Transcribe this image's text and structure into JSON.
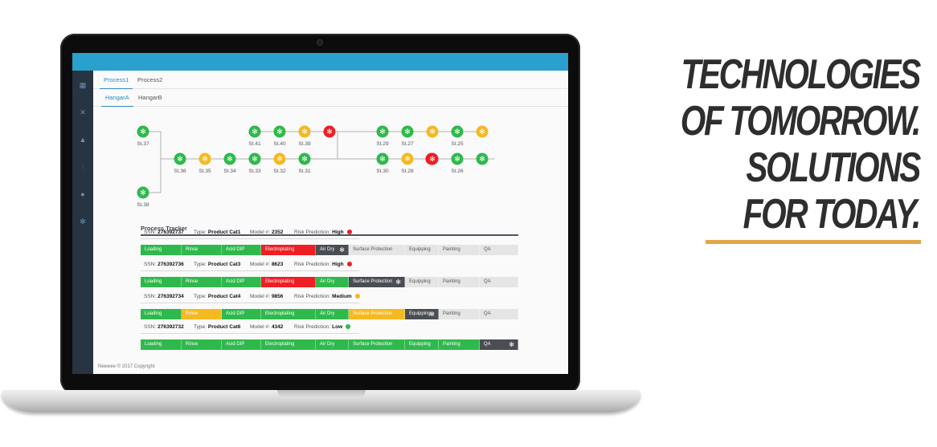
{
  "colors": {
    "green": "#2fb94c",
    "yellow": "#f5b921",
    "red": "#ee1e24",
    "dark": "#4a4d52",
    "pending": "#e5e5e5",
    "accent_line": "#e2a54a",
    "topbar": "#2aa0cc",
    "sidebar": "#273442"
  },
  "sidebar_icons": [
    "dashboard-icon",
    "tools-icon",
    "alert-icon",
    "sliders-icon",
    "users-icon",
    "settings-icon"
  ],
  "process_tabs": [
    {
      "label": "Process1",
      "active": true
    },
    {
      "label": "Process2",
      "active": false
    }
  ],
  "hangar_tabs": [
    {
      "label": "HangarA",
      "active": true
    },
    {
      "label": "HangarB",
      "active": false
    }
  ],
  "stations": [
    {
      "label": "St.37",
      "status": "green"
    },
    {
      "label": "St.38",
      "status": "green"
    },
    {
      "label": "St.36",
      "status": "green"
    },
    {
      "label": "St.35",
      "status": "yellow"
    },
    {
      "label": "St.34",
      "status": "green"
    },
    {
      "label": "St.33",
      "status": "green"
    },
    {
      "label": "St.32",
      "status": "yellow"
    },
    {
      "label": "St.31",
      "status": "green"
    },
    {
      "label": "St.41",
      "status": "green"
    },
    {
      "label": "St.40",
      "status": "green"
    },
    {
      "label": "St.39",
      "status": "yellow"
    },
    {
      "label": "",
      "status": "red"
    },
    {
      "label": "",
      "status": "red"
    },
    {
      "label": "St.29",
      "status": "green"
    },
    {
      "label": "St.27",
      "status": "green"
    },
    {
      "label": "",
      "status": "yellow"
    },
    {
      "label": "St.25",
      "status": "green"
    },
    {
      "label": "",
      "status": "yellow"
    },
    {
      "label": "St.30",
      "status": "green"
    },
    {
      "label": "St.28",
      "status": "yellow"
    },
    {
      "label": "",
      "status": "red"
    },
    {
      "label": "St.26",
      "status": "green"
    },
    {
      "label": "",
      "status": "green"
    }
  ],
  "tracker": {
    "title": "Process Tracker",
    "labels": {
      "ssn": "SSN:",
      "type": "Type:",
      "model": "Model #:",
      "risk": "Risk Prediction:"
    },
    "stage_names": [
      "Loading",
      "Rinse",
      "Acid DIP",
      "Electroplating",
      "Air Dry",
      "Surface Protection",
      "Equipping",
      "Painting",
      "QA"
    ],
    "items": [
      {
        "ssn": "276392737",
        "type": "Product Cat1",
        "model": "2352",
        "risk": "High",
        "risk_color": "red",
        "stages": [
          "green",
          "green",
          "green",
          "red",
          "dark",
          "pending",
          "pending",
          "pending",
          "pending"
        ]
      },
      {
        "ssn": "276392736",
        "type": "Product Cat3",
        "model": "8623",
        "risk": "High",
        "risk_color": "red",
        "stages": [
          "green",
          "green",
          "green",
          "red",
          "green",
          "dark",
          "pending",
          "pending",
          "pending"
        ]
      },
      {
        "ssn": "276392734",
        "type": "Product Cat4",
        "model": "9856",
        "risk": "Medium",
        "risk_color": "yellow",
        "stages": [
          "green",
          "yellow",
          "green",
          "green",
          "green",
          "yellow",
          "dark",
          "pending",
          "pending"
        ]
      },
      {
        "ssn": "276392732",
        "type": "Product Cat6",
        "model": "4342",
        "risk": "Low",
        "risk_color": "green",
        "stages": [
          "green",
          "green",
          "green",
          "green",
          "green",
          "green",
          "green",
          "green",
          "dark"
        ]
      }
    ]
  },
  "footer": "Neewee © 2017 Copyright",
  "headline": {
    "line1": "TECHNOLOGIES",
    "line2": "OF TOMORROW.",
    "line3": "SOLUTIONS",
    "line4": "FOR TODAY."
  }
}
